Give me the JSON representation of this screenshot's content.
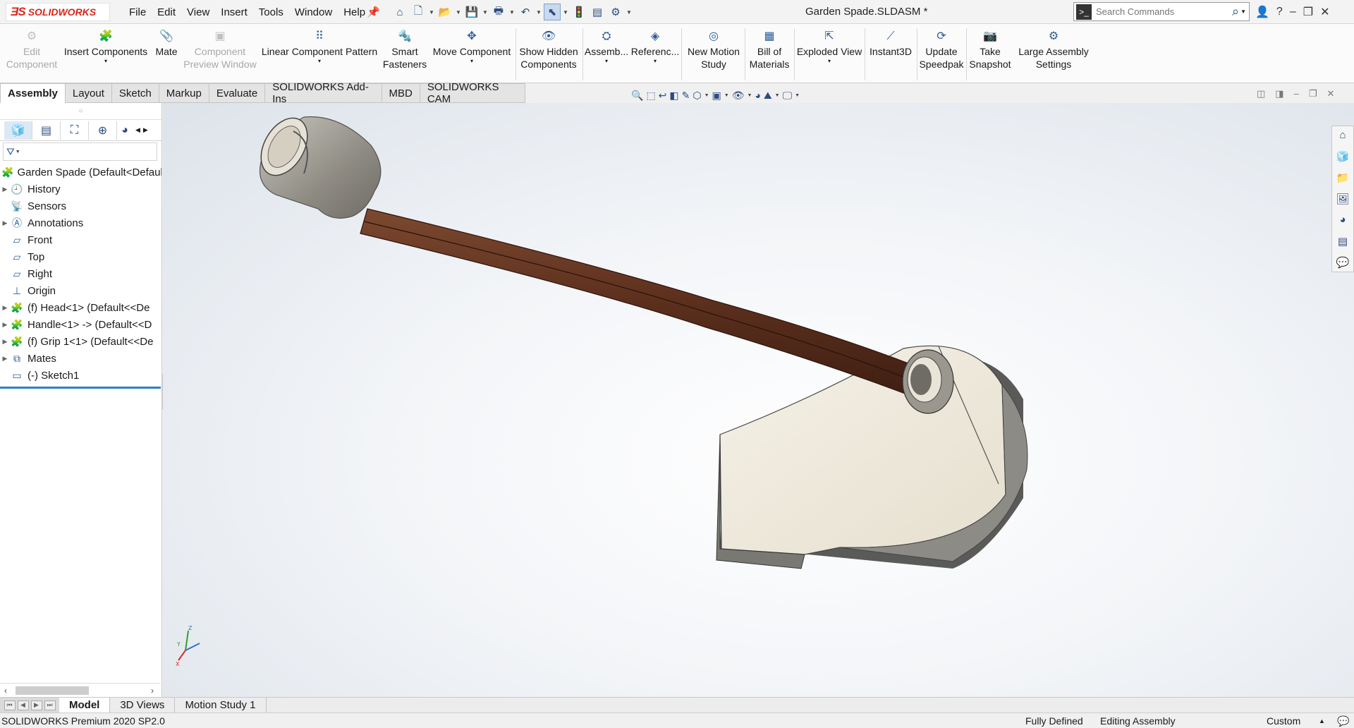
{
  "app": {
    "logo_mark": "ƎS",
    "logo_text": "SOLIDWORKS",
    "document_title": "Garden Spade.SLDASM *"
  },
  "menu": [
    "File",
    "Edit",
    "View",
    "Insert",
    "Tools",
    "Window",
    "Help"
  ],
  "search": {
    "placeholder": "Search Commands"
  },
  "window_controls": {
    "user": "👤",
    "help": "?",
    "minimize": "–",
    "restore": "❐",
    "close": "✕"
  },
  "commands": {
    "edit_component": [
      "Edit",
      "Component"
    ],
    "insert_components": "Insert Components",
    "mate": "Mate",
    "component_preview": [
      "Component",
      "Preview Window"
    ],
    "linear_pattern": "Linear Component Pattern",
    "smart_fasteners": [
      "Smart",
      "Fasteners"
    ],
    "move_component": "Move Component",
    "show_hidden": [
      "Show Hidden",
      "Components"
    ],
    "assembly_features": "Assemb...",
    "reference_geometry": "Referenc...",
    "new_motion_study": [
      "New Motion",
      "Study"
    ],
    "bill_of_materials": [
      "Bill of",
      "Materials"
    ],
    "exploded_view": "Exploded View",
    "instant3d": "Instant3D",
    "update_speedpak": [
      "Update",
      "Speedpak"
    ],
    "take_snapshot": [
      "Take",
      "Snapshot"
    ],
    "large_assembly": [
      "Large Assembly",
      "Settings"
    ]
  },
  "command_tabs": [
    "Assembly",
    "Layout",
    "Sketch",
    "Markup",
    "Evaluate",
    "SOLIDWORKS Add-Ins",
    "MBD",
    "SOLIDWORKS CAM"
  ],
  "feature_tree": {
    "root": "Garden Spade  (Default<Default",
    "items": [
      {
        "label": "History",
        "expandable": true,
        "icon": "history-icon"
      },
      {
        "label": "Sensors",
        "expandable": false,
        "icon": "sensors-icon"
      },
      {
        "label": "Annotations",
        "expandable": true,
        "icon": "annotations-icon"
      },
      {
        "label": "Front",
        "expandable": false,
        "icon": "plane-icon"
      },
      {
        "label": "Top",
        "expandable": false,
        "icon": "plane-icon"
      },
      {
        "label": "Right",
        "expandable": false,
        "icon": "plane-icon"
      },
      {
        "label": "Origin",
        "expandable": false,
        "icon": "origin-icon"
      },
      {
        "label": "(f) Head<1> (Default<<De",
        "expandable": true,
        "icon": "part-icon"
      },
      {
        "label": "Handle<1> -> (Default<<D",
        "expandable": true,
        "icon": "part-icon"
      },
      {
        "label": "(f) Grip 1<1> (Default<<De",
        "expandable": true,
        "icon": "part-icon"
      },
      {
        "label": "Mates",
        "expandable": true,
        "icon": "mates-icon"
      },
      {
        "label": "(-) Sketch1",
        "expandable": false,
        "icon": "sketch-icon"
      }
    ]
  },
  "bottom_tabs": [
    "Model",
    "3D Views",
    "Motion Study 1"
  ],
  "status": {
    "version": "SOLIDWORKS Premium 2020 SP2.0",
    "defined": "Fully Defined",
    "mode": "Editing Assembly",
    "units": "Custom"
  },
  "triad": {
    "z": "Z",
    "y": "Y",
    "x": "X"
  },
  "colors": {
    "brand_red": "#d9261c",
    "accent_blue": "#2d80c6",
    "handle_wood": "#6b3a24",
    "blade": "#ece6d8",
    "grip": "#a9a79f"
  }
}
